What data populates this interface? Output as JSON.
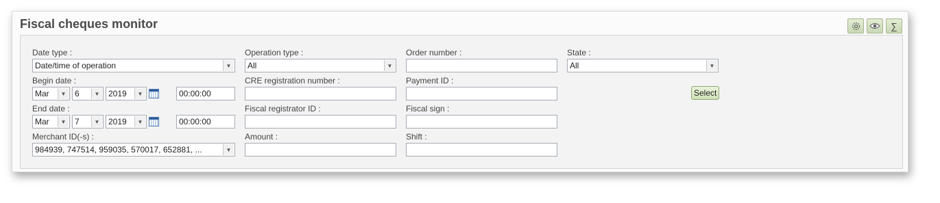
{
  "title": "Fiscal cheques monitor",
  "toolbar": {
    "icons": [
      "settings-icon",
      "eye-icon",
      "sum-icon"
    ],
    "sum_glyph": "∑"
  },
  "filters": {
    "date_type": {
      "label": "Date type :",
      "value": "Date/time of operation"
    },
    "begin_date": {
      "label": "Begin date :",
      "month": "Mar",
      "day": "6",
      "year": "2019",
      "time": "00:00:00"
    },
    "end_date": {
      "label": "End date :",
      "month": "Mar",
      "day": "7",
      "year": "2019",
      "time": "00:00:00"
    },
    "merchant_ids": {
      "label": "Merchant ID(-s) :",
      "value": "984939, 747514, 959035, 570017, 652881, ..."
    },
    "operation_type": {
      "label": "Operation type :",
      "value": "All"
    },
    "cre_registration_number": {
      "label": "CRE registration number :",
      "value": ""
    },
    "fiscal_registrator_id": {
      "label": "Fiscal registrator ID :",
      "value": ""
    },
    "amount": {
      "label": "Amount :",
      "value": ""
    },
    "order_number": {
      "label": "Order number :",
      "value": ""
    },
    "payment_id": {
      "label": "Payment ID :",
      "value": ""
    },
    "fiscal_sign": {
      "label": "Fiscal sign :",
      "value": ""
    },
    "shift": {
      "label": "Shift :",
      "value": ""
    },
    "state": {
      "label": "State :",
      "value": "All"
    },
    "select_button": "Select"
  }
}
